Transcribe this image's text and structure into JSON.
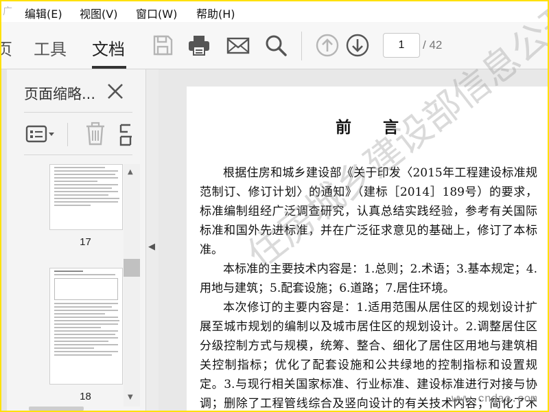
{
  "menu": {
    "watermark_fragment": "广",
    "items": [
      "编辑(E)",
      "视图(V)",
      "窗口(W)",
      "帮助(H)"
    ]
  },
  "toolbar": {
    "tabs": [
      "页",
      "工具",
      "文档"
    ],
    "active_tab": "文档",
    "icons": [
      "save-icon",
      "print-icon",
      "email-icon",
      "search-icon",
      "page-up-icon",
      "page-down-icon"
    ],
    "current_page": "1",
    "total_pages": "/ 42"
  },
  "left_panel": {
    "title": "页面缩略...",
    "tools": [
      "options-icon",
      "delete-icon",
      "extract-icon"
    ],
    "thumbnails": [
      {
        "page": "17"
      },
      {
        "page": "18"
      }
    ]
  },
  "document": {
    "title": "前言",
    "paragraphs": [
      "根据住房和城乡建设部《关于印发〈2015年工程建设标准规范制订、修订计划〉的通知》（建标［2014］189号）的要求，标准编制组经广泛调查研究，认真总结实践经验，参考有关国际标准和国外先进标准，并在广泛征求意见的基础上，修订了本标准。",
      "本标准的主要技术内容是：1.总则；2.术语；3.基本规定；4.用地与建筑；5.配套设施；6.道路；7.居住环境。",
      "本次修订的主要内容是：1.适用范围从居住区的规划设计扩展至城市规划的编制以及城市居住区的规划设计。2.调整居住区分级控制方式与规模，统筹、整合、细化了居住区用地与建筑相关控制指标；优化了配套设施和公共绿地的控制指标和设置规定。3.与现行相关国家标准、行业标准、建设标准进行对接与协调；删除了工程管线综合及竖向设计的有关技术内容；简化了术语概念。"
    ],
    "watermark": "住房城乡建设部信息公开",
    "site_watermark": "www.cndao.com"
  },
  "colors": {
    "frame_border": "#ffe100",
    "toolbar_bg": "#f7f7f7",
    "icon_gray": "#555555"
  }
}
